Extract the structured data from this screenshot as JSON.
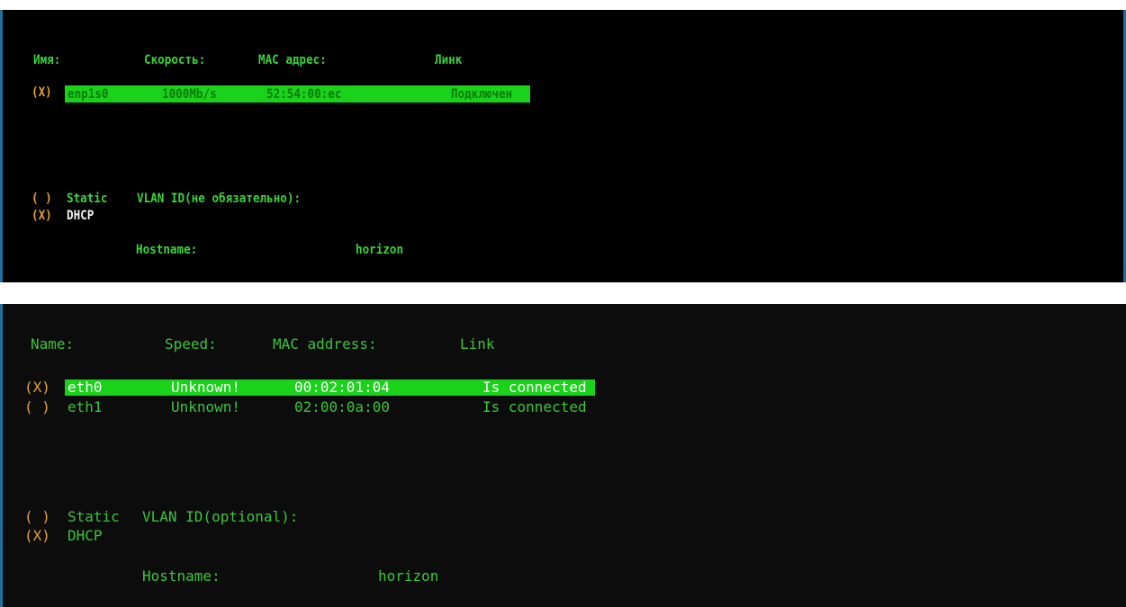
{
  "colors": {
    "terminal_bg_top": "#000000",
    "terminal_bg_bottom": "#0c0c0c",
    "text_green": "#3ad23a",
    "selection_green": "#1ad21a",
    "radio_orange": "#e7a12e",
    "frame_blue": "#1f6f9f"
  },
  "russian": {
    "headers": {
      "name": "Имя:",
      "speed": "Скорость:",
      "mac": "MAC адрес:",
      "link": "Линк"
    },
    "interfaces": [
      {
        "radio": "(X)",
        "name": "enp1s0",
        "speed": "1000Mb/s",
        "mac": "52:54:00:ec",
        "link": "Подключен",
        "selected": true
      }
    ],
    "ip_mode": {
      "static_radio": "( )",
      "static_label": "Static",
      "vlan_label": "VLAN ID(не обязательно):",
      "dhcp_radio": "(X)",
      "dhcp_label": "DHCP"
    },
    "hostname_label": "Hostname:",
    "hostname_value": "horizon"
  },
  "english": {
    "headers": {
      "name": "Name:",
      "speed": "Speed:",
      "mac": "MAC address:",
      "link": "Link"
    },
    "interfaces": [
      {
        "radio": "(X)",
        "name": "eth0",
        "speed": "Unknown!",
        "mac": "00:02:01:04",
        "link": "Is connected",
        "selected": true
      },
      {
        "radio": "( )",
        "name": "eth1",
        "speed": "Unknown!",
        "mac": "02:00:0a:00",
        "link": "Is connected",
        "selected": false
      }
    ],
    "ip_mode": {
      "static_radio": "( )",
      "static_label": "Static",
      "vlan_label": "VLAN ID(optional):",
      "dhcp_radio": "(X)",
      "dhcp_label": "DHCP"
    },
    "hostname_label": "Hostname:",
    "hostname_value": "horizon"
  }
}
